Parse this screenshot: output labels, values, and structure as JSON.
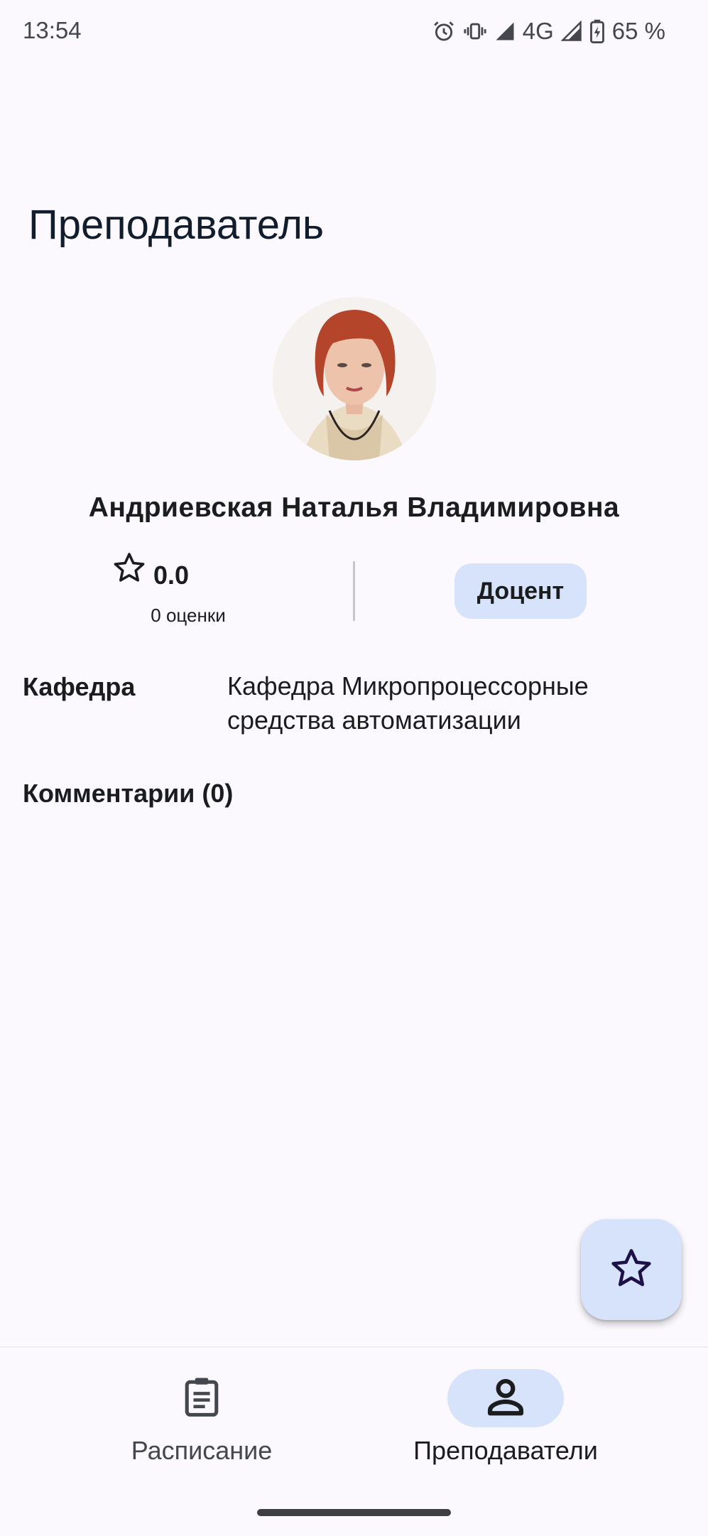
{
  "status_bar": {
    "time": "13:54",
    "network": "4G",
    "battery": "65 %",
    "icons": [
      "alarm-icon",
      "vibrate-icon",
      "signal-icon",
      "signal-icon",
      "battery-charging-icon"
    ]
  },
  "page": {
    "title": "Преподаватель"
  },
  "teacher": {
    "name": "Андриевская Наталья Владимировна",
    "rating_value": "0.0",
    "rating_count": "0 оценки",
    "position": "Доцент"
  },
  "info": {
    "department_label": "Кафедра",
    "department_value": "Кафедра Микропроцессорные средства автоматизации"
  },
  "comments": {
    "title": "Комментарии (0)"
  },
  "bottom_nav": {
    "items": [
      {
        "label": "Расписание",
        "icon": "clipboard-icon",
        "active": false
      },
      {
        "label": "Преподаватели",
        "icon": "person-icon",
        "active": true
      }
    ]
  },
  "colors": {
    "background": "#fbf9fd",
    "chip": "#d6e3fa",
    "fab": "#d6e3fa",
    "fab_icon": "#1d1148"
  }
}
